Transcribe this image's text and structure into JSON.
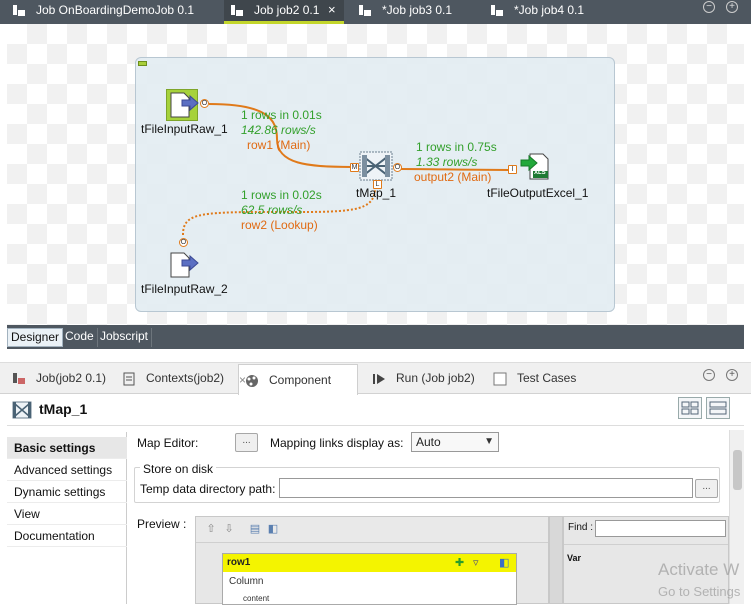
{
  "top_tabs": [
    {
      "label": "Job OnBoardingDemoJob 0.1",
      "active": false
    },
    {
      "label": "Job job2 0.1",
      "active": true
    },
    {
      "label": "*Job job3 0.1",
      "active": false
    },
    {
      "label": "*Job job4 0.1",
      "active": false
    }
  ],
  "close_glyph": "×",
  "window_buttons": {
    "minimize": "−",
    "maximize": "+"
  },
  "canvas": {
    "components": {
      "input1": "tFileInputRaw_1",
      "input2": "tFileInputRaw_2",
      "tmap": "tMap_1",
      "output": "tFileOutputExcel_1"
    },
    "links": {
      "row1": {
        "rows": "1 rows in 0.01s",
        "rate": "142.86 rows/s",
        "name": "row1 (Main)"
      },
      "row2": {
        "rows": "1 rows in 0.02s",
        "rate": "62.5 rows/s",
        "name": "row2 (Lookup)"
      },
      "output2": {
        "rows": "1 rows in 0.75s",
        "rate": "1.33 rows/s",
        "name": "output2 (Main)"
      }
    },
    "ports": {
      "out": "O",
      "main": "M",
      "lookup": "L",
      "in": "I"
    },
    "xls_badge": "XLS"
  },
  "designer_tabs": [
    "Designer",
    "Code",
    "Jobscript"
  ],
  "view_tabs": [
    {
      "label": "Job(job2 0.1)",
      "icon": "job-icon"
    },
    {
      "label": "Contexts(job2)",
      "icon": "contexts-icon"
    },
    {
      "label": "Component",
      "icon": "component-icon",
      "active": true
    },
    {
      "label": "Run (Job job2)",
      "icon": "run-icon"
    },
    {
      "label": "Test Cases",
      "icon": "test-cases-icon"
    }
  ],
  "component_title": "tMap_1",
  "settings_nav": [
    "Basic settings",
    "Advanced settings",
    "Dynamic settings",
    "View",
    "Documentation"
  ],
  "settings": {
    "map_editor_label": "Map Editor:",
    "ellipsis": "...",
    "mapping_links_label": "Mapping links display as:",
    "mapping_links_value": "Auto",
    "store_on_disk_label": "Store on disk",
    "temp_dir_label": "Temp data directory path:",
    "temp_dir_value": "",
    "preview_label": "Preview :"
  },
  "preview": {
    "row1_title": "row1",
    "column_header": "Column",
    "column_value": "content",
    "find_label": "Find :",
    "var_label": "Var"
  },
  "watermark": {
    "line1": "Activate W",
    "line2": "Go to Settings"
  },
  "colors": {
    "accent_green": "#a6d23b",
    "link_orange": "#e06a12",
    "stat_green": "#33a02c",
    "tab_bar": "#4e5760"
  }
}
